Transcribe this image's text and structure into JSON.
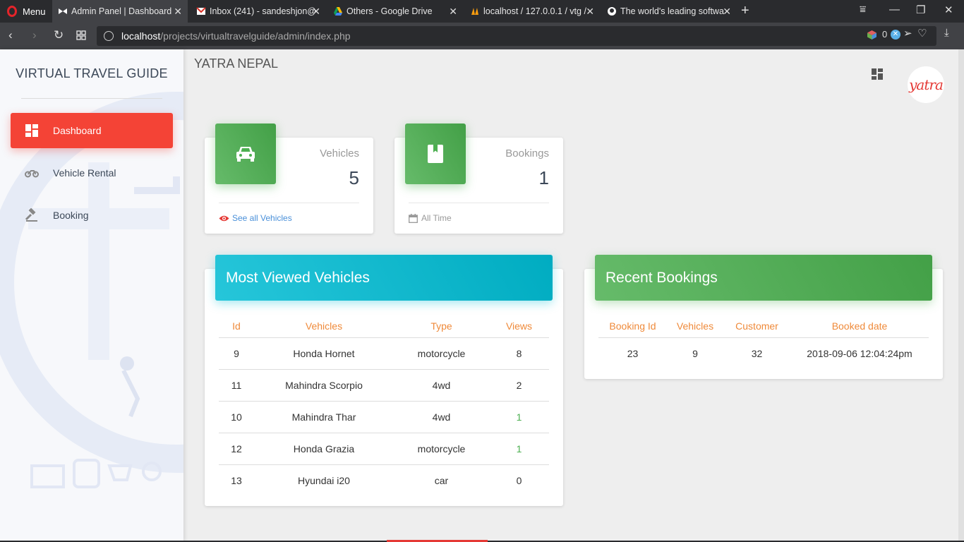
{
  "browser": {
    "menu_label": "Menu",
    "tabs": [
      {
        "title": "Admin Panel | Dashboard",
        "active": true
      },
      {
        "title": "Inbox (241) - sandeshjon@",
        "active": false
      },
      {
        "title": "Others - Google Drive",
        "active": false
      },
      {
        "title": "localhost / 127.0.0.1 / vtg /",
        "active": false
      },
      {
        "title": "The world's leading softwa",
        "active": false
      }
    ],
    "url_host": "localhost",
    "url_path": "/projects/virtualtravelguide/admin/index.php",
    "ext_badge": "0"
  },
  "sidebar": {
    "brand": "VIRTUAL TRAVEL GUIDE",
    "items": [
      {
        "label": "Dashboard",
        "icon": "dashboard-icon",
        "active": true
      },
      {
        "label": "Vehicle Rental",
        "icon": "motorcycle-icon",
        "active": false
      },
      {
        "label": "Booking",
        "icon": "gavel-icon",
        "active": false
      }
    ]
  },
  "header": {
    "title": "YATRA NEPAL",
    "logo_text": "yatra"
  },
  "stats": [
    {
      "category": "Vehicles",
      "value": "5",
      "footer": "See all Vehicles",
      "icon": "car-icon",
      "footer_icon": "eye-icon"
    },
    {
      "category": "Bookings",
      "value": "1",
      "footer": "All Time",
      "icon": "book-icon",
      "footer_icon": "calendar-icon"
    }
  ],
  "most_viewed": {
    "title": "Most Viewed Vehicles",
    "columns": [
      "Id",
      "Vehicles",
      "Type",
      "Views"
    ],
    "rows": [
      [
        "9",
        "Honda Hornet",
        "motorcycle",
        "8"
      ],
      [
        "11",
        "Mahindra Scorpio",
        "4wd",
        "2"
      ],
      [
        "10",
        "Mahindra Thar",
        "4wd",
        "1"
      ],
      [
        "12",
        "Honda Grazia",
        "motorcycle",
        "1"
      ],
      [
        "13",
        "Hyundai i20",
        "car",
        "0"
      ]
    ]
  },
  "recent_bookings": {
    "title": "Recent Bookings",
    "columns": [
      "Booking Id",
      "Vehicles",
      "Customer",
      "Booked date"
    ],
    "rows": [
      [
        "23",
        "9",
        "32",
        "2018-09-06 12:04:24pm"
      ]
    ]
  },
  "colors": {
    "active_nav": "#f44336",
    "stat_green": "#4caf50",
    "cyan_header": "#00bcd4",
    "table_header_text": "#ef8a3a"
  }
}
